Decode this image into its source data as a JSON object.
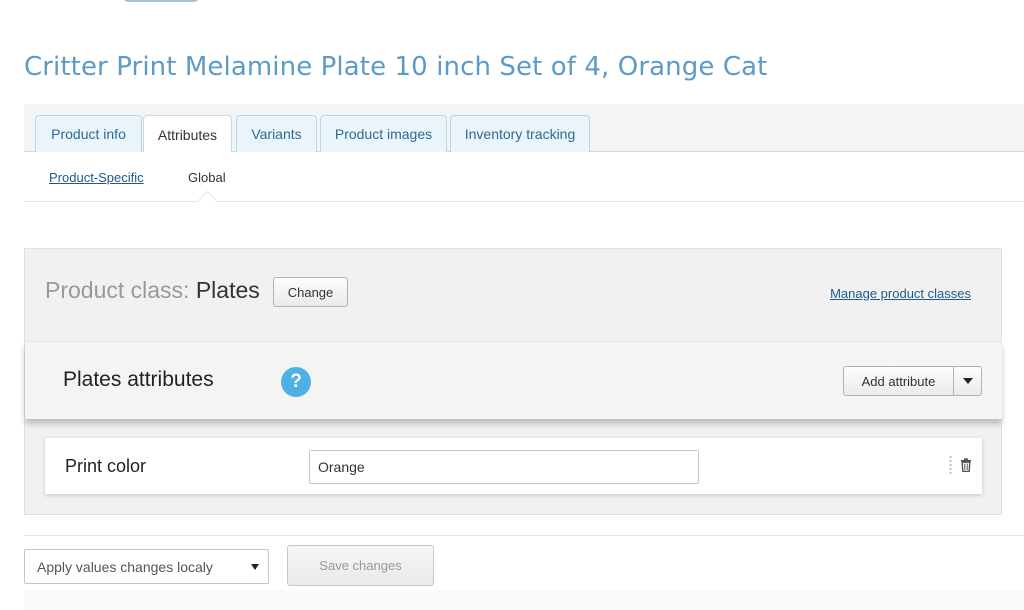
{
  "page": {
    "title": "Critter Print Melamine Plate 10 inch Set of 4, Orange Cat"
  },
  "tabs": [
    {
      "label": "Product info",
      "active": false
    },
    {
      "label": "Attributes",
      "active": true
    },
    {
      "label": "Variants",
      "active": false
    },
    {
      "label": "Product images",
      "active": false
    },
    {
      "label": "Inventory tracking",
      "active": false
    }
  ],
  "subtabs": [
    {
      "label": "Product-Specific",
      "active": false
    },
    {
      "label": "Global",
      "active": true
    }
  ],
  "product_class": {
    "label": "Product class:",
    "value": "Plates",
    "change_label": "Change",
    "manage_link": "Manage product classes"
  },
  "attributes_panel": {
    "title": "Plates attributes",
    "help_icon": "?",
    "add_attribute_label": "Add attribute"
  },
  "attribute_rows": [
    {
      "name": "Print color",
      "value": "Orange"
    }
  ],
  "footer": {
    "apply_select_value": "Apply values changes localy",
    "save_label": "Save changes"
  },
  "colors": {
    "title": "#5d9bc7",
    "link": "#1f5a8a",
    "help_icon": "#4fb0e6",
    "tab_bg": "#eaf4fb"
  },
  "icons": {
    "help": "question-icon",
    "trash": "trash-icon",
    "drag": "drag-handle-icon",
    "dropdown": "chevron-down-icon"
  }
}
